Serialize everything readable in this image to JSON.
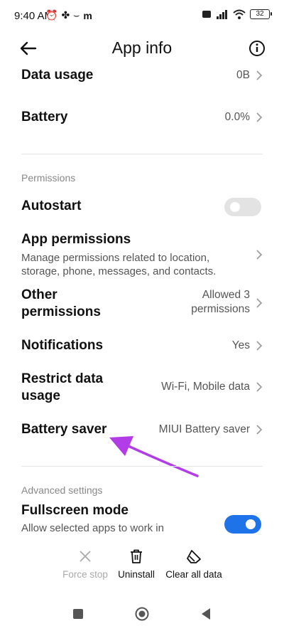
{
  "status": {
    "time": "9:40 AM",
    "left_icons": [
      "alarm-icon",
      "pinwheel-icon",
      "wave-icon",
      "m-icon"
    ],
    "right_icons": [
      "sim-icon",
      "signal-icon",
      "wifi-icon"
    ],
    "battery": "32"
  },
  "header": {
    "title": "App info"
  },
  "rows": {
    "data_usage": {
      "title": "Data usage",
      "value": "0B"
    },
    "battery": {
      "title": "Battery",
      "value": "0.0%"
    },
    "permissions_section": "Permissions",
    "autostart": {
      "title": "Autostart",
      "enabled": false
    },
    "app_permissions": {
      "title": "App permissions",
      "subtitle": "Manage permissions related to location, storage, phone, messages, and contacts."
    },
    "other_permissions": {
      "title_line1": "Other",
      "title_line2": "permissions",
      "value_line1": "Allowed 3",
      "value_line2": "permissions"
    },
    "notifications": {
      "title": "Notifications",
      "value": "Yes"
    },
    "restrict_data": {
      "title_line1": "Restrict data",
      "title_line2": "usage",
      "value": "Wi-Fi, Mobile data"
    },
    "battery_saver": {
      "title": "Battery saver",
      "value": "MIUI Battery saver"
    },
    "advanced_section": "Advanced settings",
    "fullscreen": {
      "title": "Fullscreen mode",
      "subtitle": "Allow selected apps to work in",
      "enabled": true
    }
  },
  "actions": {
    "force_stop": "Force stop",
    "uninstall": "Uninstall",
    "clear_all": "Clear all data"
  },
  "colors": {
    "accent": "#1e73e8",
    "arrow": "#b23ce6"
  }
}
